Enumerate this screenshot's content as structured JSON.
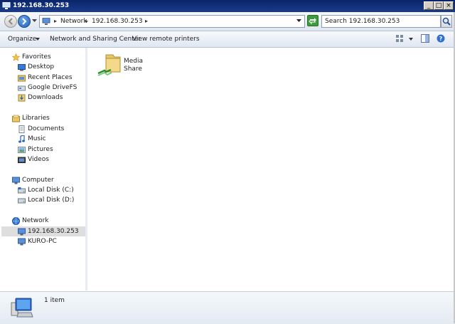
{
  "window": {
    "title": "192.168.30.253"
  },
  "address": {
    "crumbs": [
      "Network",
      "192.168.30.253"
    ]
  },
  "search": {
    "placeholder": "Search 192.168.30.253"
  },
  "toolbar": {
    "organize": "Organize",
    "network_center": "Network and Sharing Center",
    "view_printers": "View remote printers"
  },
  "sidebar": {
    "favorites": {
      "label": "Favorites",
      "items": [
        {
          "label": "Desktop"
        },
        {
          "label": "Recent Places"
        },
        {
          "label": "Google DriveFS"
        },
        {
          "label": "Downloads"
        }
      ]
    },
    "libraries": {
      "label": "Libraries",
      "items": [
        {
          "label": "Documents"
        },
        {
          "label": "Music"
        },
        {
          "label": "Pictures"
        },
        {
          "label": "Videos"
        }
      ]
    },
    "computer": {
      "label": "Computer",
      "items": [
        {
          "label": "Local Disk (C:)"
        },
        {
          "label": "Local Disk (D:)"
        }
      ]
    },
    "network": {
      "label": "Network",
      "items": [
        {
          "label": "192.168.30.253"
        },
        {
          "label": "KURO-PC"
        }
      ]
    }
  },
  "content": {
    "items": [
      {
        "line1": "Media",
        "line2": "Share"
      }
    ]
  },
  "details": {
    "count": "1 item"
  }
}
